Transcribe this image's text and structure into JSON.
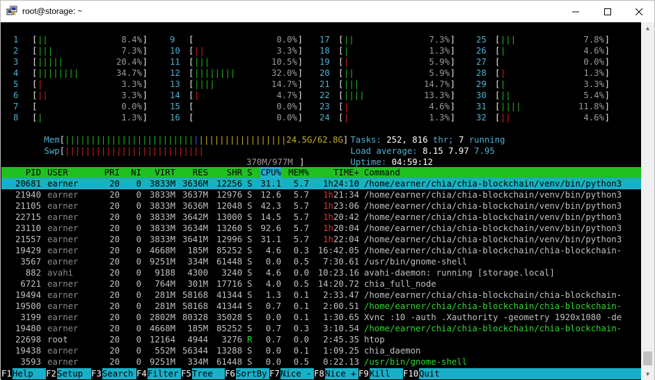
{
  "window": {
    "title": "root@storage: ~",
    "controls": {
      "minimize": "—",
      "maximize": "☐",
      "close": "✕"
    }
  },
  "cpus": [
    {
      "n": "1",
      "bar": "||",
      "color": "g",
      "val": "8.4%"
    },
    {
      "n": "2",
      "bar": "|||",
      "color": "g",
      "val": "7.3%"
    },
    {
      "n": "3",
      "bar": "|||||",
      "color": "g",
      "val": "20.4%"
    },
    {
      "n": "4",
      "bar": "||||||||",
      "color": "g",
      "val": "34.7%"
    },
    {
      "n": "5",
      "bar": "|",
      "color": "r",
      "val": "3.3%"
    },
    {
      "n": "6",
      "bar": "||",
      "color": "r",
      "val": "3.3%"
    },
    {
      "n": "7",
      "bar": "",
      "color": "g",
      "val": "0.0%"
    },
    {
      "n": "8",
      "bar": "|",
      "color": "g",
      "val": "1.3%"
    },
    {
      "n": "9",
      "bar": "",
      "color": "g",
      "val": "0.0%"
    },
    {
      "n": "10",
      "bar": "||",
      "color": "r",
      "val": "3.3%"
    },
    {
      "n": "11",
      "bar": "|||",
      "color": "g",
      "val": "10.5%"
    },
    {
      "n": "12",
      "bar": "||||||||",
      "color": "g",
      "val": "32.0%"
    },
    {
      "n": "13",
      "bar": "||||",
      "color": "g",
      "val": "14.7%"
    },
    {
      "n": "14",
      "bar": "|",
      "color": "r",
      "val": "4.7%"
    },
    {
      "n": "15",
      "bar": "",
      "color": "g",
      "val": "0.0%"
    },
    {
      "n": "16",
      "bar": "",
      "color": "g",
      "val": "0.0%"
    },
    {
      "n": "17",
      "bar": "||",
      "color": "g",
      "val": "7.3%"
    },
    {
      "n": "18",
      "bar": "|",
      "color": "g",
      "val": "1.3%"
    },
    {
      "n": "19",
      "bar": "|",
      "color": "r",
      "val": "5.9%"
    },
    {
      "n": "20",
      "bar": "||",
      "color": "g",
      "val": "5.9%"
    },
    {
      "n": "21",
      "bar": "|||",
      "color": "g",
      "val": "14.7%"
    },
    {
      "n": "22",
      "bar": "||||",
      "color": "g",
      "val": "13.3%"
    },
    {
      "n": "23",
      "bar": "|",
      "color": "r",
      "val": "4.6%"
    },
    {
      "n": "24",
      "bar": "|",
      "color": "r",
      "val": "1.3%"
    },
    {
      "n": "25",
      "bar": "|||",
      "color": "g",
      "val": "7.8%"
    },
    {
      "n": "26",
      "bar": "|",
      "color": "g",
      "val": "4.6%"
    },
    {
      "n": "27",
      "bar": "",
      "color": "g",
      "val": "0.0%"
    },
    {
      "n": "28",
      "bar": "|",
      "color": "r",
      "val": "1.3%"
    },
    {
      "n": "29",
      "bar": "|",
      "color": "g",
      "val": "3.3%"
    },
    {
      "n": "30",
      "bar": "||",
      "color": "g",
      "val": "5.4%"
    },
    {
      "n": "31",
      "bar": "||||",
      "color": "g",
      "val": "11.8%"
    },
    {
      "n": "32",
      "bar": "||",
      "color": "r",
      "val": "4.6%"
    }
  ],
  "memory": {
    "label": "Mem",
    "bar_green": "|||||||||||||||||||||||||",
    "bar_blue": "|",
    "bar_yellow": "|||||||||||||||||",
    "value": "24.5G/62.8G"
  },
  "swap": {
    "label": "Swp",
    "bar_red": "|||||||||||||||||||||||||||",
    "value": "370M/977M"
  },
  "tasks": {
    "label": "Tasks:",
    "count": "252,",
    "threads": "816",
    "thr_label": "thr;",
    "running": "7",
    "running_label": "running"
  },
  "load": {
    "label": "Load average:",
    "v1": "8.15",
    "v5": "7.97",
    "v15": "7.95"
  },
  "uptime": {
    "label": "Uptime:",
    "value": "04:59:12"
  },
  "columns": [
    "PID",
    "USER",
    "PRI",
    "NI",
    "VIRT",
    "RES",
    "SHR",
    "S",
    "CPU%",
    "MEM%",
    "TIME+",
    "Command"
  ],
  "processes": [
    {
      "pid": "20681",
      "user": "earner",
      "pri": "20",
      "ni": "0",
      "virt": "3833M",
      "res": "3636M",
      "shr": "12256",
      "s": "S",
      "cpu": "31.1",
      "mem": "5.7",
      "th": "1h",
      "tm": "24:10",
      "cmd": "/home/earner/chia/chia-blockchain/venv/bin/python3",
      "sel": true
    },
    {
      "pid": "21940",
      "user": "earner",
      "pri": "20",
      "ni": "0",
      "virt": "3833M",
      "res": "3637M",
      "shr": "12976",
      "s": "S",
      "cpu": "12.6",
      "mem": "5.7",
      "th": "1h",
      "tm": "21:34",
      "cmd": "/home/earner/chia/chia-blockchain/venv/bin/python3"
    },
    {
      "pid": "21105",
      "user": "earner",
      "pri": "20",
      "ni": "0",
      "virt": "3833M",
      "res": "3636M",
      "shr": "12048",
      "s": "S",
      "cpu": "42.3",
      "mem": "5.7",
      "th": "1h",
      "tm": "23:06",
      "cmd": "/home/earner/chia/chia-blockchain/venv/bin/python3"
    },
    {
      "pid": "22715",
      "user": "earner",
      "pri": "20",
      "ni": "0",
      "virt": "3833M",
      "res": "3642M",
      "shr": "13000",
      "s": "S",
      "cpu": "14.5",
      "mem": "5.7",
      "th": "1h",
      "tm": "20:42",
      "cmd": "/home/earner/chia/chia-blockchain/venv/bin/python3"
    },
    {
      "pid": "23110",
      "user": "earner",
      "pri": "20",
      "ni": "0",
      "virt": "3833M",
      "res": "3634M",
      "shr": "13260",
      "s": "S",
      "cpu": "92.6",
      "mem": "5.7",
      "th": "1h",
      "tm": "20:04",
      "cmd": "/home/earner/chia/chia-blockchain/venv/bin/python3"
    },
    {
      "pid": "21557",
      "user": "earner",
      "pri": "20",
      "ni": "0",
      "virt": "3833M",
      "res": "3641M",
      "shr": "12996",
      "s": "S",
      "cpu": "31.1",
      "mem": "5.7",
      "th": "1h",
      "tm": "22:04",
      "cmd": "/home/earner/chia/chia-blockchain/venv/bin/python3"
    },
    {
      "pid": "19429",
      "user": "earner",
      "pri": "20",
      "ni": "0",
      "virt": "4668M",
      "res": "185M",
      "shr": "85252",
      "s": "S",
      "cpu": "4.6",
      "mem": "0.3",
      "th": "",
      "tm": "16:42.05",
      "cmd": "/home/earner/chia/chia-blockchain/chia-blockchain-"
    },
    {
      "pid": "3567",
      "user": "earner",
      "pri": "20",
      "ni": "0",
      "virt": "9251M",
      "res": "334M",
      "shr": "61448",
      "s": "S",
      "cpu": "0.0",
      "mem": "0.5",
      "th": "",
      "tm": "7:30.61",
      "cmd": "/usr/bin/gnome-shell"
    },
    {
      "pid": "882",
      "user": "avahi",
      "pri": "20",
      "ni": "0",
      "virt": "9188",
      "res": "4300",
      "shr": "3240",
      "s": "S",
      "cpu": "4.6",
      "mem": "0.0",
      "th": "",
      "tm": "10:23.16",
      "cmd": "avahi-daemon: running [storage.local]"
    },
    {
      "pid": "6721",
      "user": "earner",
      "pri": "20",
      "ni": "0",
      "virt": "764M",
      "res": "301M",
      "shr": "17716",
      "s": "S",
      "cpu": "4.0",
      "mem": "0.5",
      "th": "",
      "tm": "14:20.72",
      "cmd": "chia_full_node"
    },
    {
      "pid": "19494",
      "user": "earner",
      "pri": "20",
      "ni": "0",
      "virt": "281M",
      "res": "58168",
      "shr": "41344",
      "s": "S",
      "cpu": "1.3",
      "mem": "0.1",
      "th": "",
      "tm": "2:33.47",
      "cmd": "/home/earner/chia/chia-blockchain/chia-blockchain-"
    },
    {
      "pid": "19500",
      "user": "earner",
      "pri": "20",
      "ni": "0",
      "virt": "281M",
      "res": "58168",
      "shr": "41344",
      "s": "S",
      "cpu": "0.7",
      "mem": "0.1",
      "th": "",
      "tm": "2:00.51",
      "cmd": "/home/earner/chia/chia-blockchain/chia-blockchain-",
      "green": true
    },
    {
      "pid": "3199",
      "user": "earner",
      "pri": "20",
      "ni": "0",
      "virt": "2802M",
      "res": "80328",
      "shr": "35028",
      "s": "S",
      "cpu": "0.0",
      "mem": "0.1",
      "th": "",
      "tm": "1:30.65",
      "cmd": "Xvnc :10 -auth .Xauthority -geometry 1920x1080 -de"
    },
    {
      "pid": "19480",
      "user": "earner",
      "pri": "20",
      "ni": "0",
      "virt": "4668M",
      "res": "185M",
      "shr": "85252",
      "s": "S",
      "cpu": "0.7",
      "mem": "0.3",
      "th": "",
      "tm": "3:10.54",
      "cmd": "/home/earner/chia/chia-blockchain/chia-blockchain-",
      "green": true
    },
    {
      "pid": "22698",
      "user": "root",
      "pri": "20",
      "ni": "0",
      "virt": "12164",
      "res": "4944",
      "shr": "3276",
      "s": "R",
      "cpu": "0.7",
      "mem": "0.0",
      "th": "",
      "tm": "2:45.35",
      "cmd": "htop"
    },
    {
      "pid": "19438",
      "user": "earner",
      "pri": "20",
      "ni": "0",
      "virt": "552M",
      "res": "56344",
      "shr": "13288",
      "s": "S",
      "cpu": "0.0",
      "mem": "0.1",
      "th": "",
      "tm": "1:09.25",
      "cmd": "chia_daemon"
    },
    {
      "pid": "3593",
      "user": "earner",
      "pri": "20",
      "ni": "0",
      "virt": "9251M",
      "res": "334M",
      "shr": "61448",
      "s": "S",
      "cpu": "0.0",
      "mem": "0.5",
      "th": "",
      "tm": "0:22.13",
      "cmd": "/usr/bin/gnome-shell",
      "green": true
    }
  ],
  "fkeys": [
    {
      "key": "F1",
      "label": "Help"
    },
    {
      "key": "F2",
      "label": "Setup"
    },
    {
      "key": "F3",
      "label": "Search"
    },
    {
      "key": "F4",
      "label": "Filter"
    },
    {
      "key": "F5",
      "label": "Tree"
    },
    {
      "key": "F6",
      "label": "SortBy"
    },
    {
      "key": "F7",
      "label": "Nice -"
    },
    {
      "key": "F8",
      "label": "Nice +"
    },
    {
      "key": "F9",
      "label": "Kill"
    },
    {
      "key": "F10",
      "label": "Quit"
    }
  ]
}
